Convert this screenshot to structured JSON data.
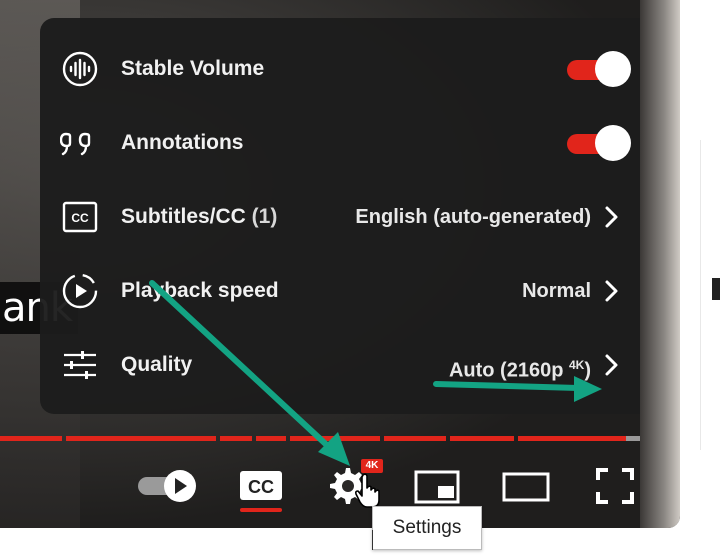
{
  "video": {
    "caption_fragment": "ank"
  },
  "menu": {
    "items": [
      {
        "icon": "stable-volume-icon",
        "label": "Stable Volume",
        "control": "toggle",
        "on": true
      },
      {
        "icon": "annotations-icon",
        "label": "Annotations",
        "control": "toggle",
        "on": true
      },
      {
        "icon": "subtitles-icon",
        "label": "Subtitles/CC",
        "label_count": " (1)",
        "value": "English (auto-generated)",
        "control": "submenu"
      },
      {
        "icon": "playback-speed-icon",
        "label": "Playback speed",
        "value": "Normal",
        "control": "submenu"
      },
      {
        "icon": "quality-icon",
        "label": "Quality",
        "value": "Auto (2160p ",
        "value_sup": "4K",
        "value_close": ")",
        "control": "submenu"
      }
    ]
  },
  "controls": {
    "autoplay": {
      "icon": "autoplay-toggle-icon"
    },
    "subtitles": {
      "icon": "cc-icon",
      "text": "CC"
    },
    "settings": {
      "icon": "gear-icon",
      "badge": "4K"
    },
    "miniplayer": {
      "icon": "miniplayer-icon"
    },
    "theater": {
      "icon": "theater-mode-icon"
    },
    "fullscreen": {
      "icon": "fullscreen-icon"
    }
  },
  "tooltip": {
    "text": "Settings"
  },
  "colors": {
    "accent": "#e1251b",
    "annotation_arrow": "#13a383",
    "menu_bg": "#1c1c1c"
  }
}
